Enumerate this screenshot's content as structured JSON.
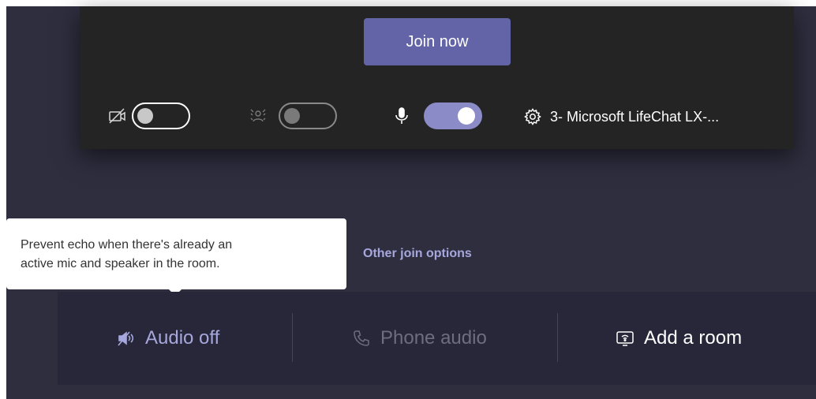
{
  "prejoin": {
    "join_button": "Join now",
    "controls": {
      "camera": {
        "icon": "camera-off-icon",
        "state": "off"
      },
      "background_effects": {
        "icon": "background-blur-icon",
        "state": "off",
        "disabled": true
      },
      "microphone": {
        "icon": "microphone-icon",
        "state": "on"
      },
      "device_settings": {
        "icon": "gear-icon",
        "label": "3- Microsoft LifeChat LX-..."
      }
    }
  },
  "tooltip": {
    "line1": "Prevent echo when there's already an",
    "line2": "active mic and speaker in the room."
  },
  "other_join_options": "Other join options",
  "audio_options": {
    "audio_off": {
      "label": "Audio off",
      "icon": "speaker-off-icon",
      "selected": true
    },
    "phone_audio": {
      "label": "Phone audio",
      "icon": "phone-icon",
      "disabled": true
    },
    "add_room": {
      "label": "Add a room",
      "icon": "room-device-icon"
    }
  },
  "colors": {
    "accent": "#6264a7",
    "toggle_on": "#8b8cc7",
    "link": "#a6a7dc",
    "panel": "#242424",
    "background": "#2f2e3f"
  }
}
